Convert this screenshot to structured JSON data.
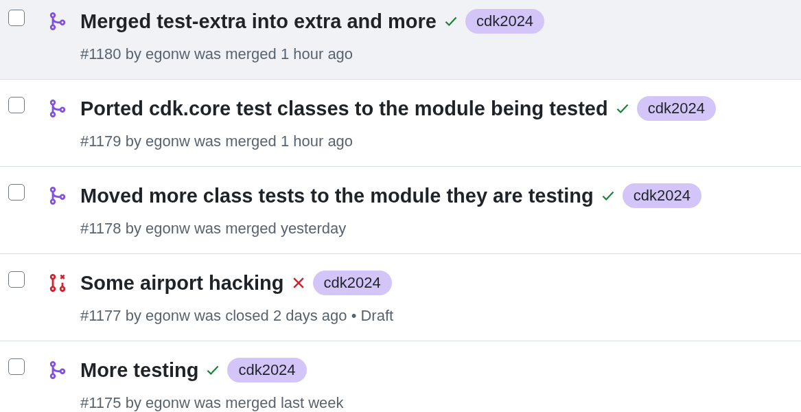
{
  "pull_requests": [
    {
      "title": "Merged test-extra into extra and more",
      "kind": "merged",
      "checks_passed": true,
      "label": "cdk2024",
      "meta": "#1180 by egonw was merged 1 hour ago",
      "highlighted": true,
      "checked": false
    },
    {
      "title": "Ported cdk.core test classes to the module being tested",
      "kind": "merged",
      "checks_passed": true,
      "label": "cdk2024",
      "meta": "#1179 by egonw was merged 1 hour ago",
      "highlighted": false,
      "checked": false
    },
    {
      "title": "Moved more class tests to the module they are testing",
      "kind": "merged",
      "checks_passed": true,
      "label": "cdk2024",
      "meta": "#1178 by egonw was merged yesterday",
      "highlighted": false,
      "checked": false
    },
    {
      "title": "Some airport hacking",
      "kind": "closed",
      "checks_passed": false,
      "label": "cdk2024",
      "meta": "#1177 by egonw was closed 2 days ago • Draft",
      "highlighted": false,
      "checked": false
    },
    {
      "title": "More testing",
      "kind": "merged",
      "checks_passed": true,
      "label": "cdk2024",
      "meta": "#1175 by egonw was merged last week",
      "highlighted": false,
      "checked": false
    }
  ]
}
